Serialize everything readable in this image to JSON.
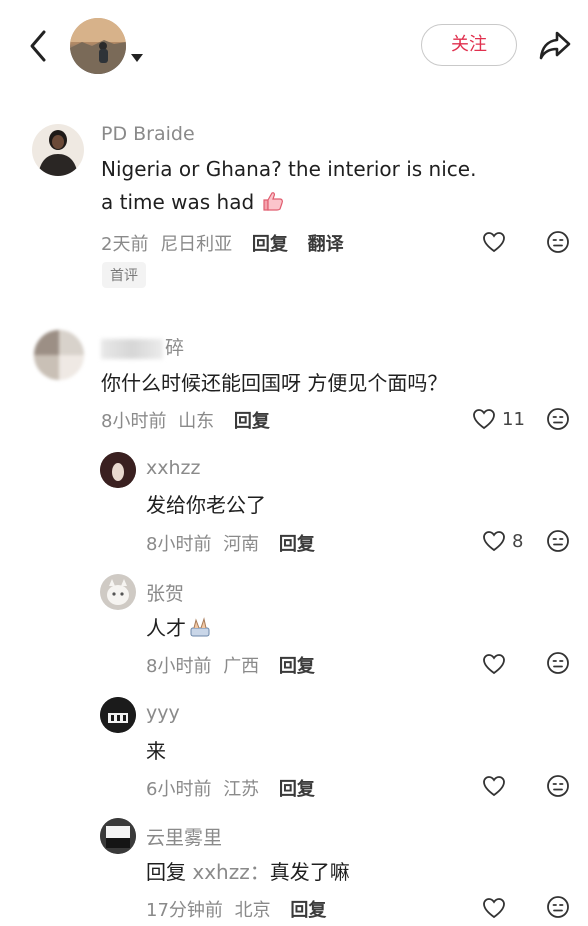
{
  "header": {
    "follow_label": "关注"
  },
  "comments": [
    {
      "name": "PD Braide",
      "lines": [
        "Nigeria or Ghana? the interior is nice.",
        "a time was had"
      ],
      "time": "2天前",
      "location": "尼日利亚",
      "reply": "回复",
      "translate": "翻译",
      "badge": "首评",
      "likes": ""
    },
    {
      "name": "碎",
      "text": "你什么时候还能回国呀 方便见个面吗？",
      "time": "8小时前",
      "location": "山东",
      "reply": "回复",
      "likes": "11"
    }
  ],
  "replies": [
    {
      "name": "xxhzz",
      "text": "发给你老公了",
      "time": "8小时前",
      "location": "河南",
      "reply": "回复",
      "likes": "8"
    },
    {
      "name": "张贺",
      "text": "人才",
      "time": "8小时前",
      "location": "广西",
      "reply": "回复",
      "likes": ""
    },
    {
      "name": "yyy",
      "text": "来",
      "time": "6小时前",
      "location": "江苏",
      "reply": "回复",
      "likes": ""
    },
    {
      "name": "云里雾里",
      "reply_prefix": "回复",
      "reply_to": "xxhzz：",
      "text": "真发了嘛",
      "time": "17分钟前",
      "location": "北京",
      "reply": "回复",
      "likes": ""
    }
  ],
  "colors": {
    "accent": "#e0304e",
    "muted": "#8a8a8a"
  }
}
